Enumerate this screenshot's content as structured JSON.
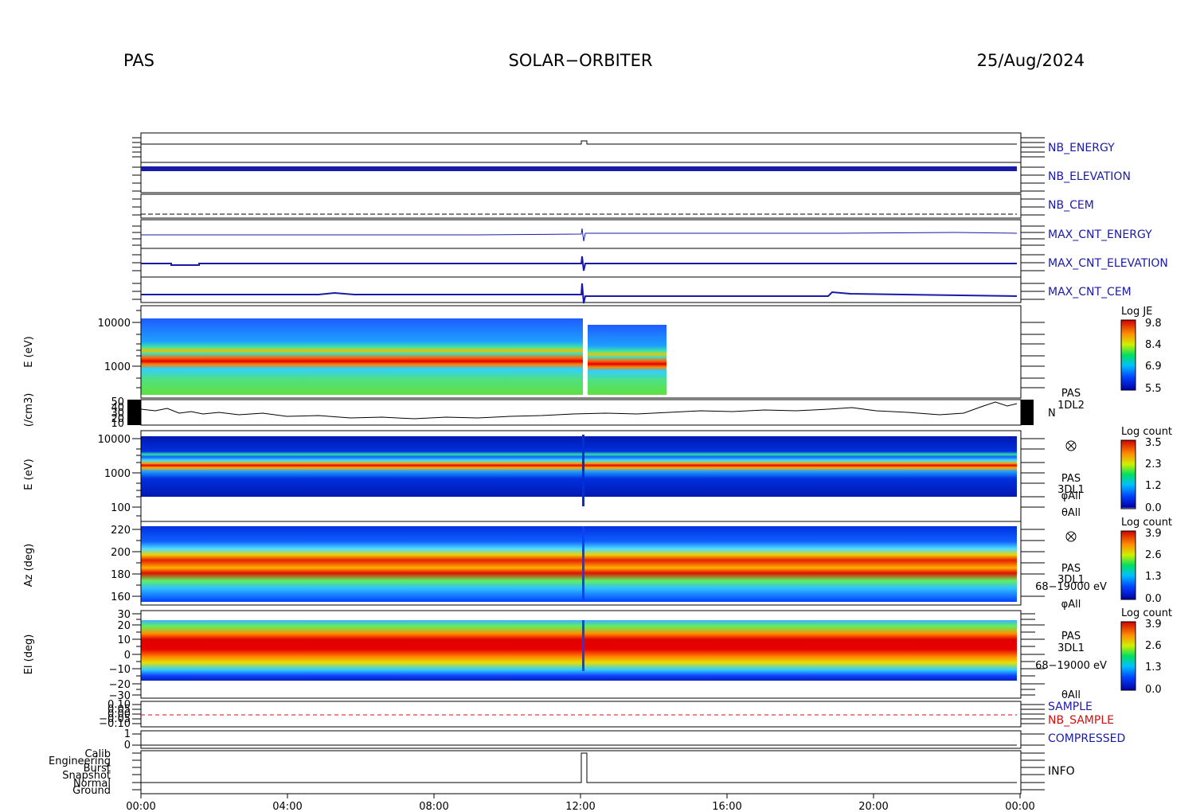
{
  "header": {
    "left": "PAS",
    "center": "SOLAR−ORBITER",
    "right": "25/Aug/2024"
  },
  "colors": {
    "trace_blue": "#1a1aa8",
    "sample_red": "#d01010",
    "axis": "#000000"
  },
  "chart_data": {
    "type": "heatmap",
    "x_ticks": [
      "00:00",
      "04:00",
      "08:00",
      "12:00",
      "16:00",
      "20:00",
      "00:00"
    ],
    "status_panels": [
      {
        "label": "NB_ENERGY",
        "color": "#1a1aa8"
      },
      {
        "label": "NB_ELEVATION",
        "color": "#1a1aa8"
      },
      {
        "label": "NB_CEM",
        "color": "#1a1aa8"
      },
      {
        "label": "MAX_CNT_ENERGY",
        "color": "#1a1aa8"
      },
      {
        "label": "MAX_CNT_ELEVATION",
        "color": "#1a1aa8"
      },
      {
        "label": "MAX_CNT_CEM",
        "color": "#1a1aa8"
      }
    ],
    "panels": [
      {
        "id": "energy_je",
        "ylabel": "E (eV)",
        "yticks": [
          "10000",
          "1000"
        ],
        "colorbar": {
          "title": "Log JE",
          "ticks": [
            "9.8",
            "8.4",
            "6.9",
            "5.5"
          ]
        },
        "data_end_hour": 14.3
      },
      {
        "id": "density",
        "ylabel": "(/cm3)",
        "yticks": [
          "50",
          "40",
          "30",
          "20",
          "10"
        ],
        "labels": [
          "PAS",
          "1DL2"
        ],
        "series_label": "N"
      },
      {
        "id": "energy_count",
        "ylabel": "E (eV)",
        "yticks": [
          "10000",
          "1000",
          "100"
        ],
        "colorbar": {
          "title": "Log count",
          "ticks": [
            "3.5",
            "2.3",
            "1.2",
            "0.0"
          ]
        },
        "labels": [
          "PAS",
          "3DL1",
          "φAll",
          "θAll"
        ]
      },
      {
        "id": "azimuth",
        "ylabel": "Az (deg)",
        "yticks": [
          "220",
          "200",
          "180",
          "160"
        ],
        "colorbar": {
          "title": "Log count",
          "ticks": [
            "3.9",
            "2.6",
            "1.3",
            "0.0"
          ]
        },
        "labels": [
          "PAS",
          "3DL1",
          "68−19000 eV",
          "φAll"
        ]
      },
      {
        "id": "elevation",
        "ylabel": "El (deg)",
        "yticks": [
          "30",
          "20",
          "10",
          "0",
          "−10",
          "−20",
          "−30"
        ],
        "colorbar": {
          "title": "Log count",
          "ticks": [
            "3.9",
            "2.6",
            "1.3",
            "0.0"
          ]
        },
        "labels": [
          "PAS",
          "3DL1",
          "68−19000 eV",
          "θAll"
        ]
      }
    ],
    "sample_panel": {
      "labels": [
        "SAMPLE",
        "NB_SAMPLE"
      ],
      "yticks": [
        "0.10",
        "0.05",
        "0.00",
        "−0.05",
        "−0.10"
      ]
    },
    "compressed_panel": {
      "label": "COMPRESSED",
      "yticks": [
        "1",
        "0"
      ]
    },
    "info_panel": {
      "label": "INFO",
      "levels": [
        "Calib",
        "Engineering",
        "Burst",
        "Snapshot",
        "Normal",
        "Ground"
      ]
    }
  }
}
